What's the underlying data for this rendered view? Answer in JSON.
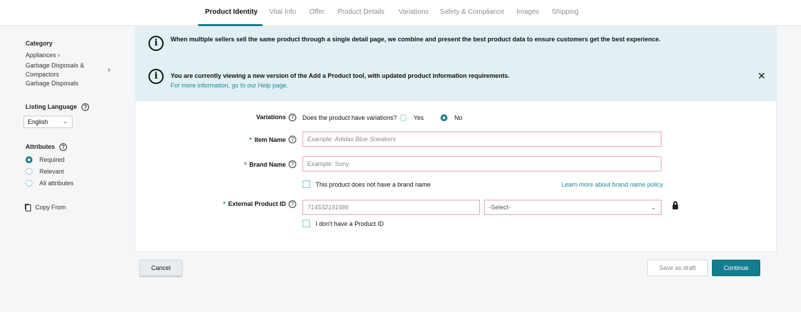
{
  "tabs": [
    "Product Identity",
    "Vital Info",
    "Offer",
    "Product Details",
    "Variations",
    "Safety & Compliance",
    "Images",
    "Shipping"
  ],
  "sidebar": {
    "category_heading": "Category",
    "category_path": [
      "Appliances",
      "Garbage Disposals &",
      "Compactors",
      "Garbage Disposals"
    ],
    "listing_language_heading": "Listing Language",
    "language_selected": "English",
    "attributes_heading": "Attributes",
    "attributes": [
      {
        "label": "Required",
        "selected": true
      },
      {
        "label": "Relevant",
        "selected": false
      },
      {
        "label": "All attributes",
        "selected": false
      }
    ],
    "copy_from": "Copy From"
  },
  "banners": {
    "first": "When multiple sellers sell the same product through a single detail page, we combine and present the best product data to ensure customers get the best experience.",
    "second": "You are currently viewing a new version of the Add a Product tool, with updated product information requirements.",
    "second_link": "For more information, go to our Help page."
  },
  "form": {
    "variations_label": "Variations",
    "variations_question": "Does the product have variations?",
    "yes": "Yes",
    "no": "No",
    "variations_value": "No",
    "item_name_label": "Item Name",
    "item_name_placeholder": "Example: Adidas Blue Sneakers",
    "brand_name_label": "Brand Name",
    "brand_name_placeholder": "Example: Sony",
    "no_brand_checkbox": "This product does not have a brand name",
    "brand_policy_link": "Learn more about brand name policy",
    "external_id_label": "External Product ID",
    "external_id_placeholder": "714532191586",
    "id_type_select": "-Select-",
    "no_product_id_checkbox": "I don't have a Product ID",
    "required_marker": "*",
    "help_glyph": "?"
  },
  "buttons": {
    "cancel": "Cancel",
    "save_draft": "Save as draft",
    "continue": "Continue"
  },
  "colors": {
    "accent": "#1a7c8c",
    "banner": "#e2f0f3",
    "error_border": "#e8a5b2"
  }
}
